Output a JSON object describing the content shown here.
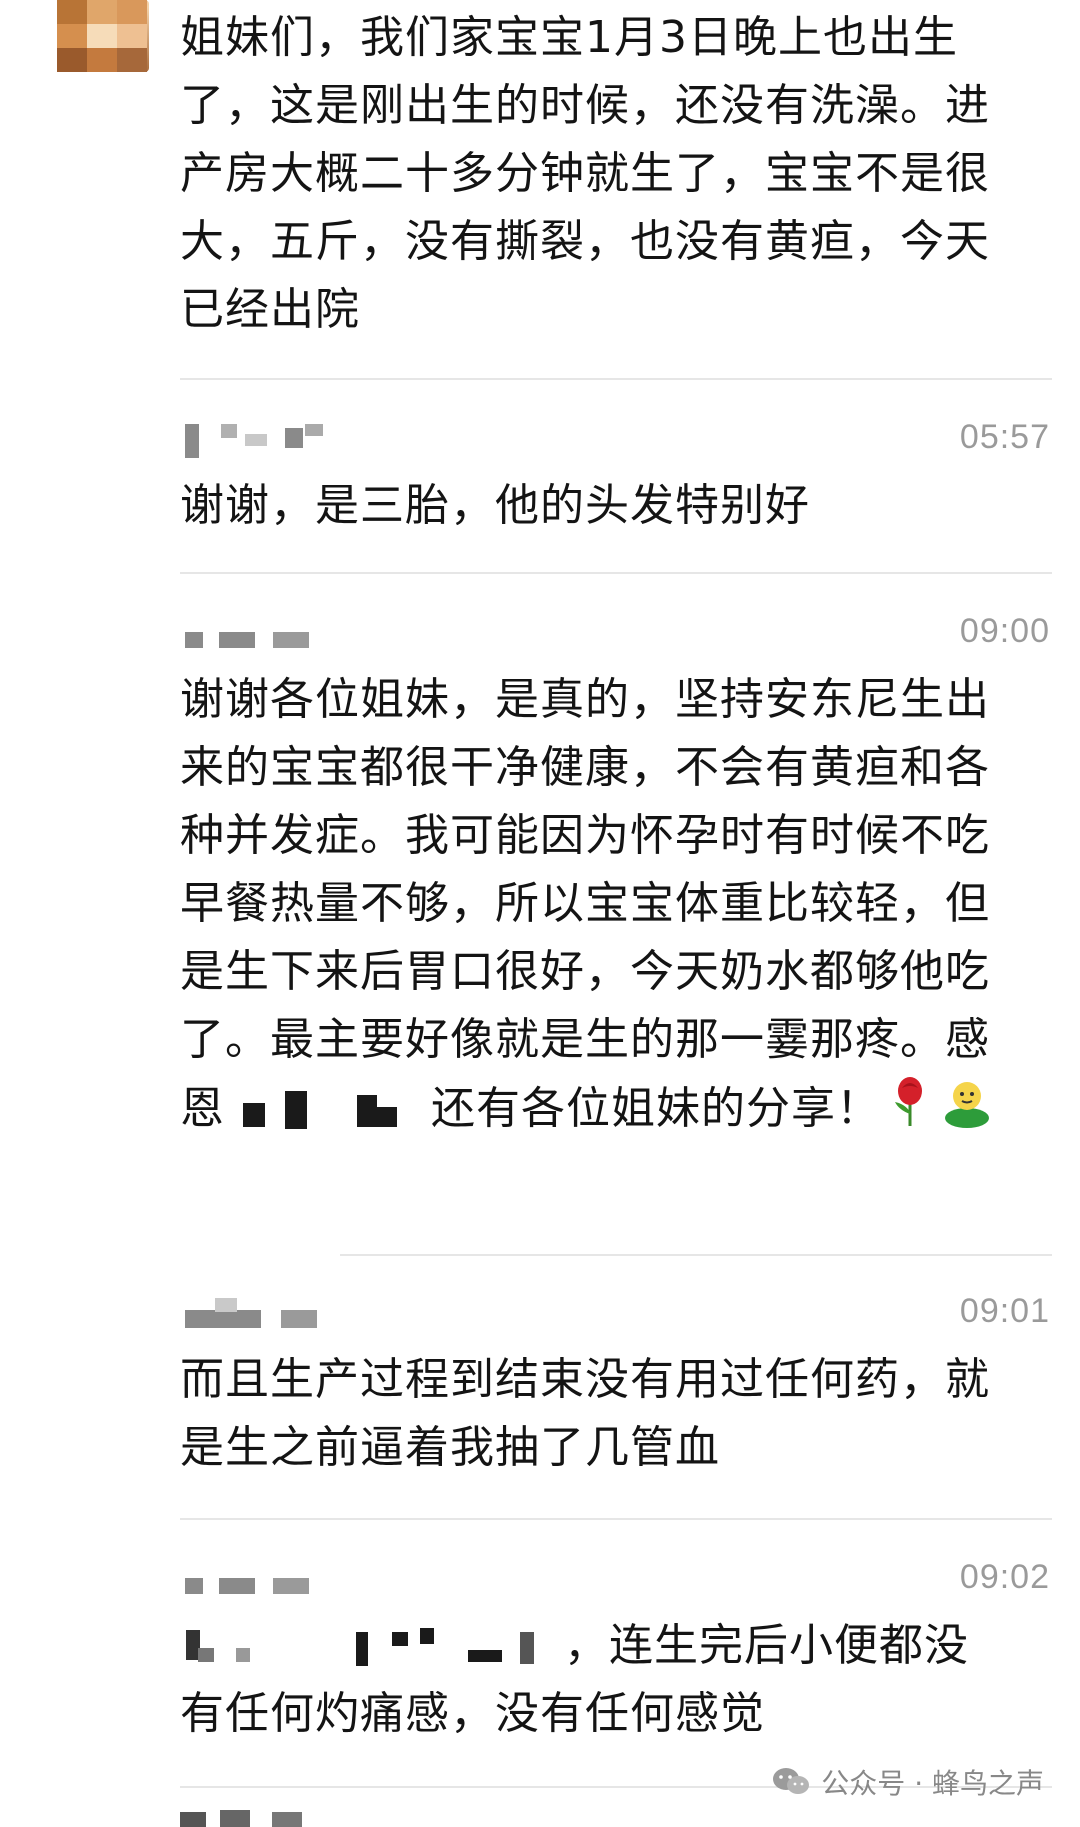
{
  "messages": [
    {
      "text": "姐妹们，我们家宝宝1月3日晚上也出生了，这是刚出生的时候，还没有洗澡。进产房大概二十多分钟就生了，宝宝不是很大，五斤，没有撕裂，也没有黄疸，今天已经出院"
    },
    {
      "time": "05:57",
      "text": "谢谢，是三胎，他的头发特别好"
    },
    {
      "time": "09:00",
      "text_before": "谢谢各位姐妹，是真的，坚持安东尼生出来的宝宝都很干净健康，不会有黄疸和各种并发症。我可能因为怀孕时有时候不吃早餐热量不够，所以宝宝体重比较轻，但是生下来后胃口很好，今天奶水都够他吃了。最主要好像就是生的那一霎那疼。感恩",
      "text_after": "还有各位姐妹的分享！",
      "emojis": [
        "rose-emoji",
        "person-emoji"
      ]
    },
    {
      "time": "09:01",
      "text": "而且生产过程到结束没有用过任何药，就是生之前逼着我抽了几管血"
    },
    {
      "time": "09:02",
      "text": "，连生完后小便都没有任何灼痛感，没有任何感觉"
    }
  ],
  "watermark": {
    "icon": "wechat-icon",
    "text": "公众号 · 蜂鸟之声"
  },
  "colors": {
    "text": "#141414",
    "time": "#9a9a9a",
    "divider": "#e6e6e6",
    "blur": "#8a8a8a"
  }
}
